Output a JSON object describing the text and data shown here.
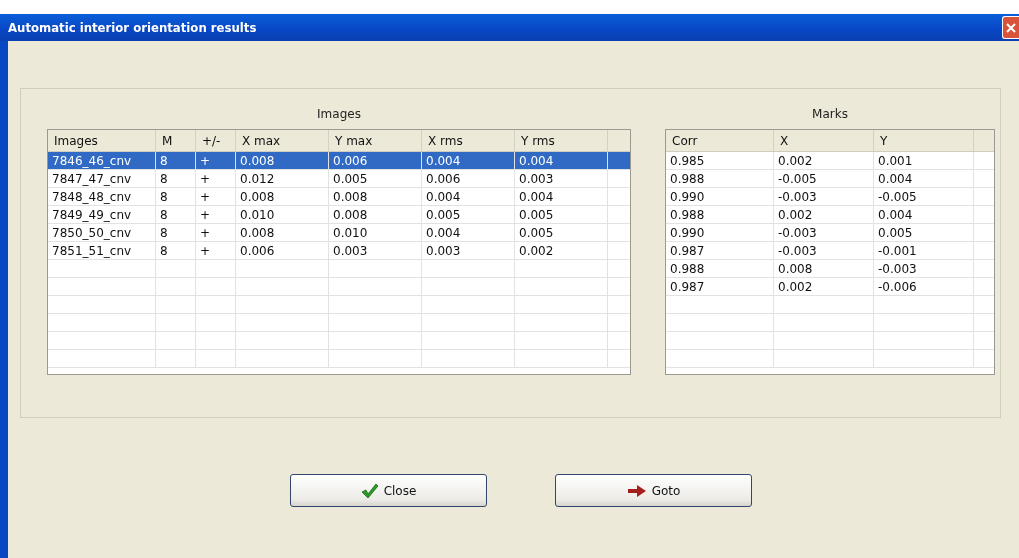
{
  "window": {
    "title": "Automatic interior orientation results"
  },
  "images_table": {
    "title": "Images",
    "columns": [
      "Images",
      "M",
      "+/-",
      "X max",
      "Y max",
      "X rms",
      "Y rms"
    ],
    "rows": [
      {
        "cells": [
          "7846_46_cnv",
          "8",
          "+",
          "0.008",
          "0.006",
          "0.004",
          "0.004"
        ],
        "selected": true
      },
      {
        "cells": [
          "7847_47_cnv",
          "8",
          "+",
          "0.012",
          "0.005",
          "0.006",
          "0.003"
        ],
        "selected": false
      },
      {
        "cells": [
          "7848_48_cnv",
          "8",
          "+",
          "0.008",
          "0.008",
          "0.004",
          "0.004"
        ],
        "selected": false
      },
      {
        "cells": [
          "7849_49_cnv",
          "8",
          "+",
          "0.010",
          "0.008",
          "0.005",
          "0.005"
        ],
        "selected": false
      },
      {
        "cells": [
          "7850_50_cnv",
          "8",
          "+",
          "0.008",
          "0.010",
          "0.004",
          "0.005"
        ],
        "selected": false
      },
      {
        "cells": [
          "7851_51_cnv",
          "8",
          "+",
          "0.006",
          "0.003",
          "0.003",
          "0.002"
        ],
        "selected": false
      }
    ]
  },
  "marks_table": {
    "title": "Marks",
    "columns": [
      "Corr",
      "X",
      "Y"
    ],
    "rows": [
      {
        "cells": [
          "0.985",
          "0.002",
          "0.001"
        ],
        "selected": false
      },
      {
        "cells": [
          "0.988",
          "-0.005",
          "0.004"
        ],
        "selected": false
      },
      {
        "cells": [
          "0.990",
          "-0.003",
          "-0.005"
        ],
        "selected": false
      },
      {
        "cells": [
          "0.988",
          "0.002",
          "0.004"
        ],
        "selected": false
      },
      {
        "cells": [
          "0.990",
          "-0.003",
          "0.005"
        ],
        "selected": false
      },
      {
        "cells": [
          "0.987",
          "-0.003",
          "-0.001"
        ],
        "selected": false
      },
      {
        "cells": [
          "0.988",
          "0.008",
          "-0.003"
        ],
        "selected": false
      },
      {
        "cells": [
          "0.987",
          "0.002",
          "-0.006"
        ],
        "selected": false
      }
    ]
  },
  "buttons": [
    {
      "label": "Close",
      "kind": "check"
    },
    {
      "label": "Goto",
      "kind": "arrow"
    }
  ]
}
